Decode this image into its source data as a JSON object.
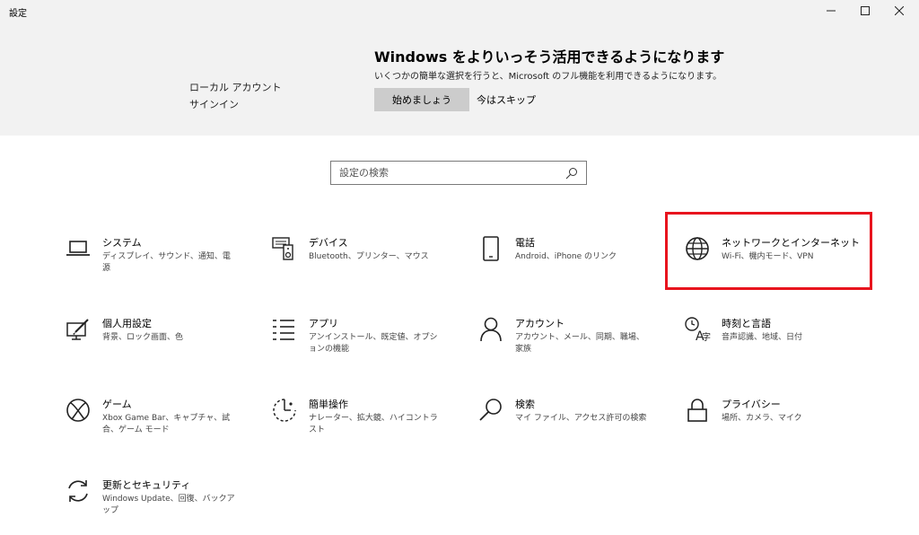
{
  "window": {
    "title": "設定"
  },
  "banner": {
    "account_line1": "ローカル アカウント",
    "account_line2": "サインイン",
    "title": "Windows をよりいっそう活用できるようになります",
    "subtitle": "いくつかの簡単な選択を行うと、Microsoft のフル機能を利用できるようになります。",
    "start_label": "始めましょう",
    "skip_label": "今はスキップ"
  },
  "search": {
    "placeholder": "設定の検索"
  },
  "tiles": [
    {
      "title": "システム",
      "desc": "ディスプレイ、サウンド、通知、電源",
      "icon": "laptop-icon"
    },
    {
      "title": "デバイス",
      "desc": "Bluetooth、プリンター、マウス",
      "icon": "devices-icon"
    },
    {
      "title": "電話",
      "desc": "Android、iPhone のリンク",
      "icon": "phone-icon"
    },
    {
      "title": "ネットワークとインターネット",
      "desc": "Wi-Fi、機内モード、VPN",
      "icon": "globe-icon"
    },
    {
      "title": "個人用設定",
      "desc": "背景、ロック画面、色",
      "icon": "personalization-icon"
    },
    {
      "title": "アプリ",
      "desc": "アンインストール、既定値、オプションの機能",
      "icon": "apps-list-icon"
    },
    {
      "title": "アカウント",
      "desc": "アカウント、メール、同期、職場、家族",
      "icon": "person-icon"
    },
    {
      "title": "時刻と言語",
      "desc": "音声認識、地域、日付",
      "icon": "time-language-icon"
    },
    {
      "title": "ゲーム",
      "desc": "Xbox Game Bar、キャプチャ、試合、ゲーム モード",
      "icon": "xbox-icon"
    },
    {
      "title": "簡単操作",
      "desc": "ナレーター、拡大鏡、ハイコントラスト",
      "icon": "ease-of-access-icon"
    },
    {
      "title": "検索",
      "desc": "マイ ファイル、アクセス許可の検索",
      "icon": "search-icon"
    },
    {
      "title": "プライバシー",
      "desc": "場所、カメラ、マイク",
      "icon": "lock-icon"
    },
    {
      "title": "更新とセキュリティ",
      "desc": "Windows Update、回復、バックアップ",
      "icon": "sync-icon"
    }
  ],
  "colors": {
    "highlight": "#e8141e",
    "banner_bg": "#f2f2f2",
    "button_bg": "#cccccc"
  }
}
